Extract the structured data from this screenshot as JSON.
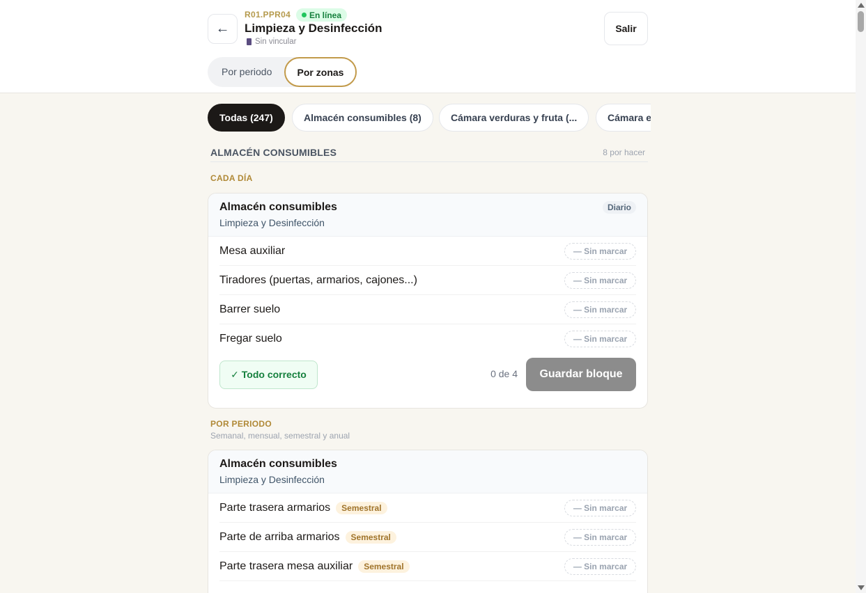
{
  "header": {
    "back_icon": "←",
    "code": "R01.PPR04",
    "status": "En línea",
    "title": "Limpieza y Desinfección",
    "subtitle": "Sin vincular",
    "exit_label": "Salir",
    "tabs": [
      {
        "label": "Por periodo",
        "active": false
      },
      {
        "label": "Por zonas",
        "active": true
      }
    ]
  },
  "chips": [
    {
      "label": "Todas (247)",
      "active": true
    },
    {
      "label": "Almacén consumibles (8)",
      "active": false
    },
    {
      "label": "Cámara verduras y fruta (...",
      "active": false
    },
    {
      "label": "Cámara e",
      "active": false
    }
  ],
  "section": {
    "title": "ALMACÉN CONSUMIBLES",
    "pending": "8 por hacer"
  },
  "daily": {
    "group_title": "CADA DÍA",
    "card": {
      "title": "Almacén consumibles",
      "subtitle": "Limpieza y Desinfección",
      "frequency": "Diario",
      "rows": [
        {
          "name": "Mesa auxiliar",
          "state": "— Sin marcar"
        },
        {
          "name": "Tiradores (puertas, armarios, cajones...)",
          "state": "— Sin marcar"
        },
        {
          "name": "Barrer suelo",
          "state": "— Sin marcar"
        },
        {
          "name": "Fregar suelo",
          "state": "— Sin marcar"
        }
      ],
      "all_ok_label": "✓ Todo correcto",
      "progress": "0 de 4",
      "save_label": "Guardar bloque"
    }
  },
  "periodic": {
    "group_title": "POR PERIODO",
    "group_subtitle": "Semanal, mensual, semestral y anual",
    "card": {
      "title": "Almacén consumibles",
      "subtitle": "Limpieza y Desinfección",
      "rows": [
        {
          "name": "Parte trasera armarios",
          "tag": "Semestral",
          "state": "— Sin marcar"
        },
        {
          "name": "Parte de arriba armarios",
          "tag": "Semestral",
          "state": "— Sin marcar"
        },
        {
          "name": "Parte trasera mesa auxiliar",
          "tag": "Semestral",
          "state": "— Sin marcar"
        }
      ]
    }
  }
}
